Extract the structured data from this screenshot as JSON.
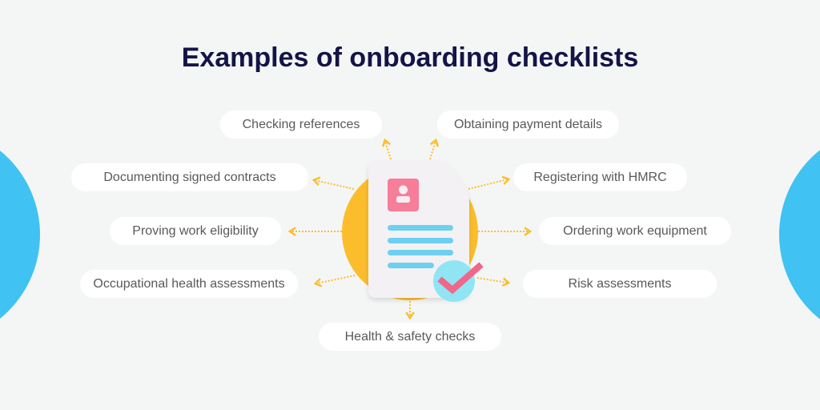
{
  "title": "Examples of onboarding checklists",
  "colors": {
    "background": "#f4f6f6",
    "title": "#141447",
    "side_circles": "#40c2f2",
    "sun": "#fbbd2b",
    "arrows": "#fbbd2b",
    "pill_bg": "#ffffff",
    "pill_text": "#58595b",
    "document": "#f3f1f4",
    "avatar_card": "#f77e98",
    "text_lines": "#6dd0f0",
    "check_badge": "#8fe5f4",
    "check_mark": "#f1668a"
  },
  "items": [
    {
      "id": "checking-references",
      "label": "Checking references"
    },
    {
      "id": "obtaining-payment-details",
      "label": "Obtaining payment details"
    },
    {
      "id": "documenting-signed-contracts",
      "label": "Documenting signed contracts"
    },
    {
      "id": "registering-with-hmrc",
      "label": "Registering with HMRC"
    },
    {
      "id": "proving-work-eligibility",
      "label": "Proving work eligibility"
    },
    {
      "id": "ordering-work-equipment",
      "label": "Ordering work equipment"
    },
    {
      "id": "occupational-health-assessments",
      "label": "Occupational health assessments"
    },
    {
      "id": "risk-assessments",
      "label": "Risk assessments"
    },
    {
      "id": "health-safety-checks",
      "label": "Health & safety checks"
    }
  ],
  "center_icon": "onboarding-document-with-checkmark-icon"
}
